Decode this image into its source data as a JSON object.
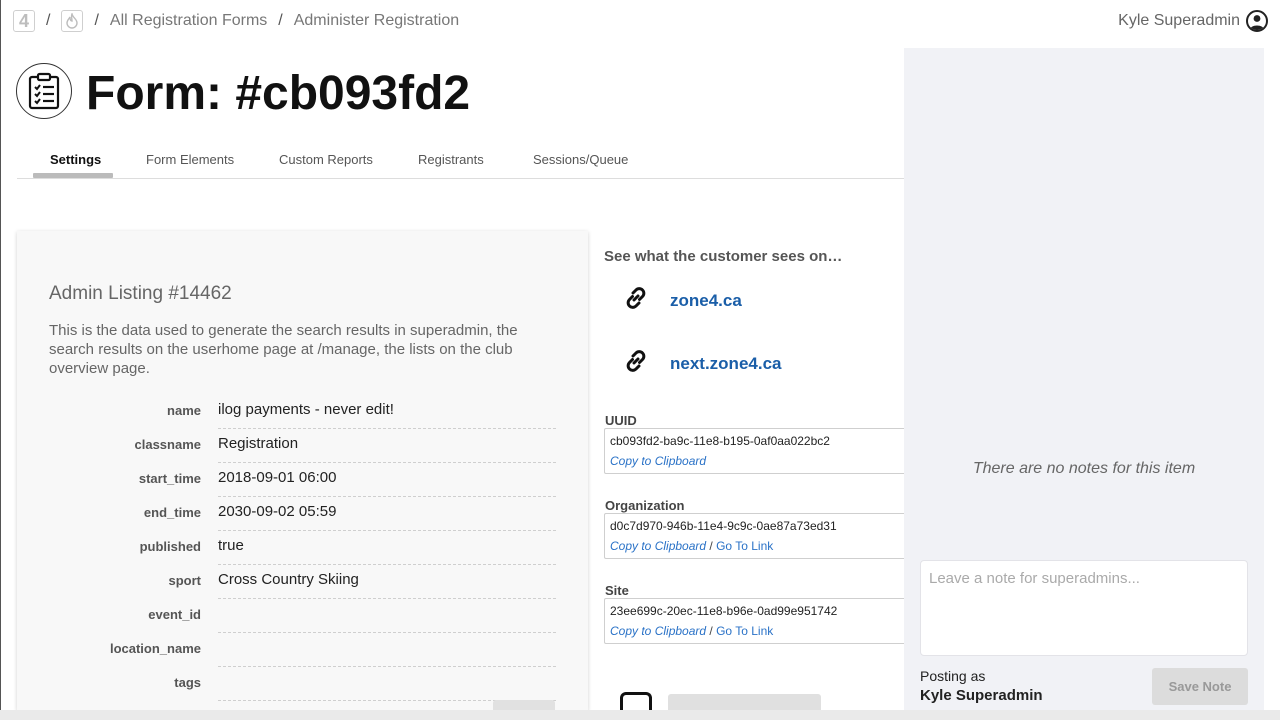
{
  "breadcrumb": {
    "home_label": "4",
    "separator": "/",
    "items": [
      "All Registration Forms",
      "Administer Registration"
    ]
  },
  "user": {
    "name": "Kyle Superadmin"
  },
  "page": {
    "title": "Form: #cb093fd2"
  },
  "tabs": [
    {
      "label": "Settings",
      "active": true
    },
    {
      "label": "Form Elements"
    },
    {
      "label": "Custom Reports"
    },
    {
      "label": "Registrants"
    },
    {
      "label": "Sessions/Queue"
    }
  ],
  "admin_listing": {
    "title": "Admin Listing #14462",
    "description": "This is the data used to generate the search results in superadmin, the search results on the userhome page at /manage, the lists on the club overview page.",
    "fields": [
      {
        "label": "name",
        "value": "ilog payments - never edit!"
      },
      {
        "label": "classname",
        "value": "Registration"
      },
      {
        "label": "start_time",
        "value": "2018-09-01 06:00"
      },
      {
        "label": "end_time",
        "value": "2030-09-02 05:59"
      },
      {
        "label": "published",
        "value": "true"
      },
      {
        "label": "sport",
        "value": "Cross Country Skiing"
      },
      {
        "label": "event_id",
        "value": ""
      },
      {
        "label": "location_name",
        "value": ""
      },
      {
        "label": "tags",
        "value": ""
      }
    ]
  },
  "customer_view": {
    "title": "See what the customer sees on…",
    "links": [
      {
        "label": "zone4.ca"
      },
      {
        "label": "next.zone4.ca"
      }
    ]
  },
  "identifiers": [
    {
      "label": "UUID",
      "value": "cb093fd2-ba9c-11e8-b195-0af0aa022bc2",
      "copy": "Copy to Clipboard",
      "go": ""
    },
    {
      "label": "Organization",
      "value": "d0c7d970-946b-11e4-9c9c-0ae87a73ed31",
      "copy": "Copy to Clipboard",
      "go": "Go To Link"
    },
    {
      "label": "Site",
      "value": "23ee699c-20ec-11e8-b96e-0ad99e951742",
      "copy": "Copy to Clipboard",
      "go": "Go To Link"
    }
  ],
  "action_separator": "/",
  "notes": {
    "empty_text": "There are no notes for this item",
    "placeholder": "Leave a note for superadmins...",
    "posting_as_label": "Posting as",
    "posting_as_user": "Kyle Superadmin",
    "save_label": "Save Note"
  },
  "colors": {
    "link": "#1a5ea8",
    "notes_bg": "#f1f2f6",
    "tab_underline": "#bbbbbb"
  }
}
